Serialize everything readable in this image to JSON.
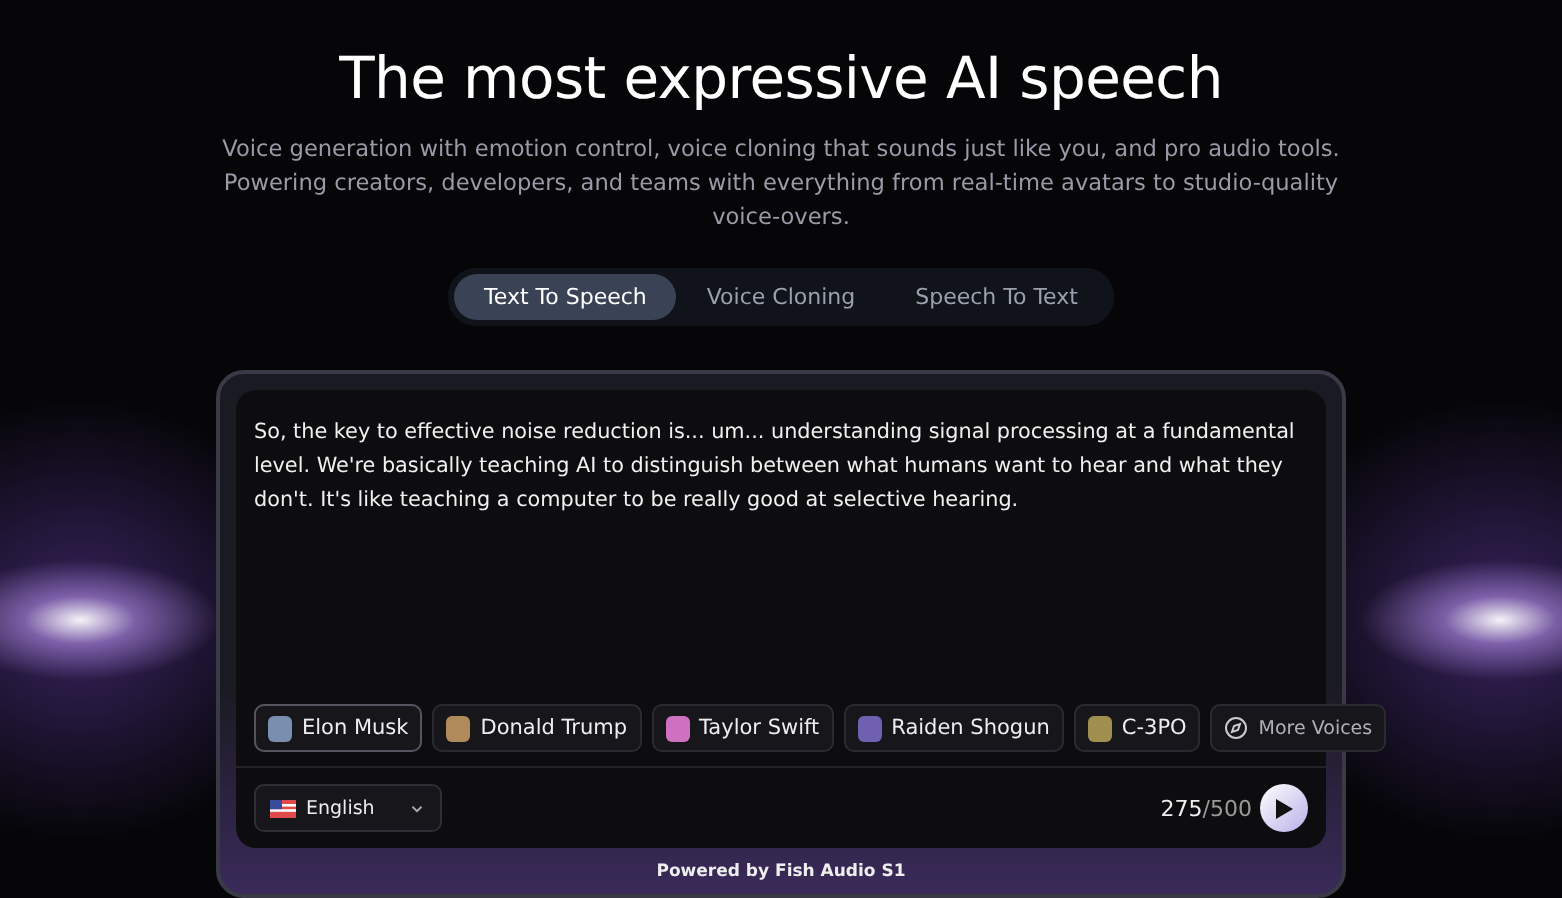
{
  "hero": {
    "title": "The most expressive AI speech",
    "subtitle": "Voice generation with emotion control, voice cloning that sounds just like you, and pro audio tools. Powering creators, developers, and teams with everything from real-time avatars to studio-quality voice-overs."
  },
  "tabs": [
    {
      "label": "Text To Speech",
      "selected": true
    },
    {
      "label": "Voice Cloning",
      "selected": false
    },
    {
      "label": "Speech To Text",
      "selected": false
    }
  ],
  "editor": {
    "text": "So, the key to effective noise reduction is... um... understanding signal processing at a fundamental level. We're basically teaching AI to distinguish between what humans want to hear and what they don't. It's like teaching a computer to be really good at selective hearing."
  },
  "voices": [
    {
      "name": "Elon Musk",
      "selected": true,
      "color": "#7a8fb0"
    },
    {
      "name": "Donald Trump",
      "selected": false,
      "color": "#b08a5a"
    },
    {
      "name": "Taylor Swift",
      "selected": false,
      "color": "#d070c0"
    },
    {
      "name": "Raiden Shogun",
      "selected": false,
      "color": "#7060b0"
    },
    {
      "name": "C-3PO",
      "selected": false,
      "color": "#a09050"
    }
  ],
  "more_voices": "More Voices",
  "language": "English",
  "counter": {
    "used": "275",
    "limit": "/500"
  },
  "footer": "Powered by Fish Audio S1"
}
